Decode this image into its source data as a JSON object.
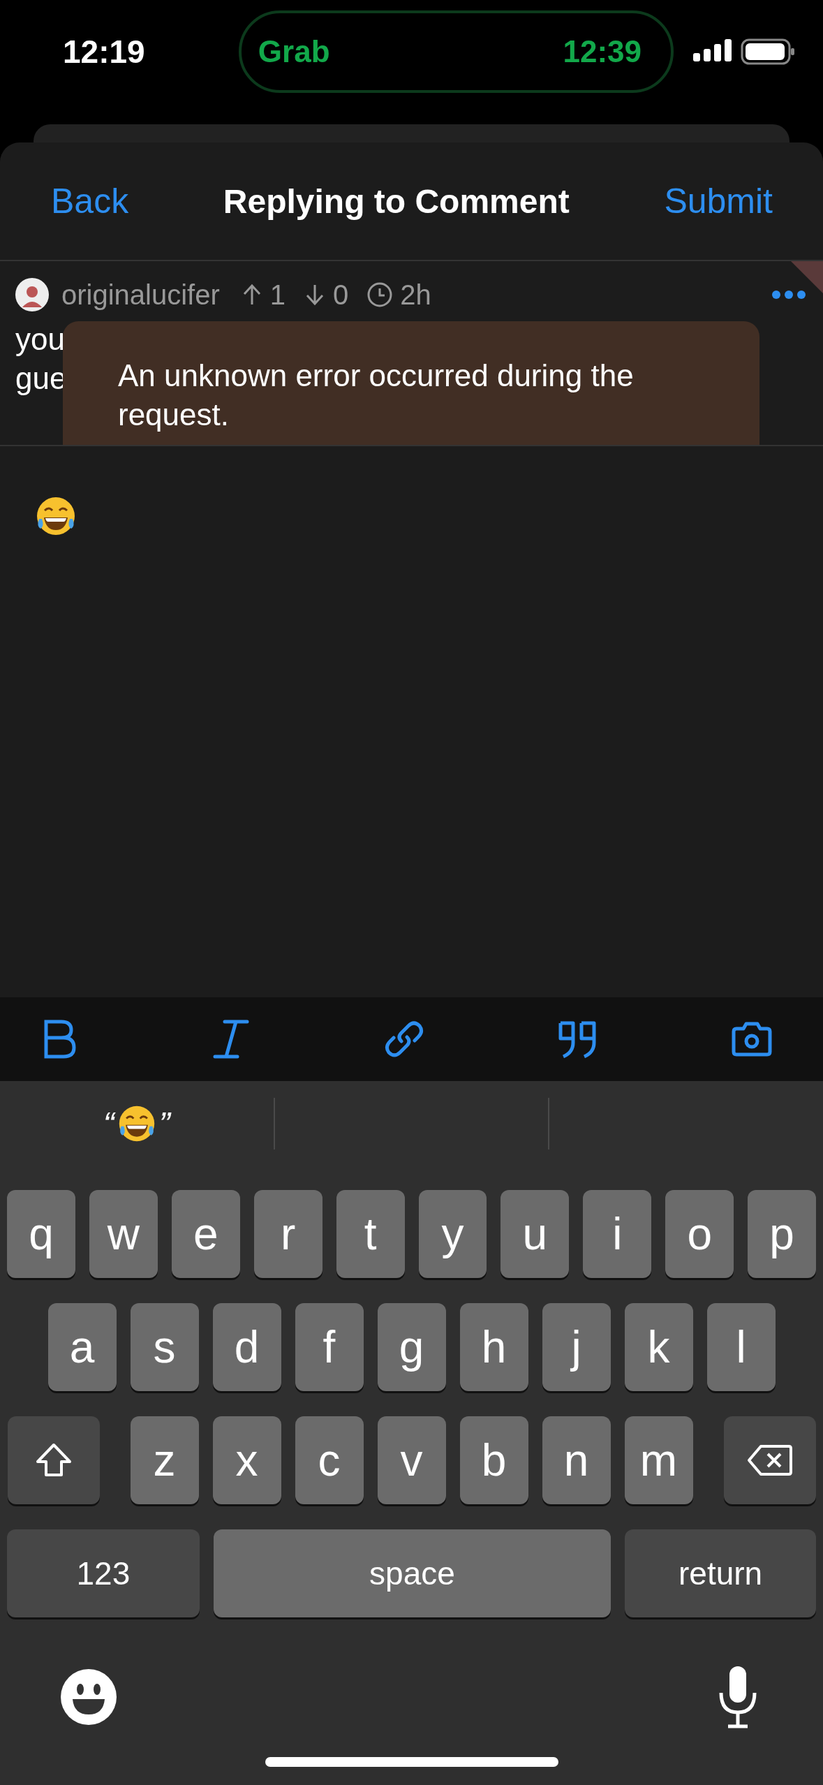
{
  "status_bar": {
    "time": "12:19",
    "island": {
      "app": "Grab",
      "time": "12:39"
    }
  },
  "nav": {
    "back": "Back",
    "title": "Replying to Comment",
    "submit": "Submit"
  },
  "comment": {
    "author": "originalucifer",
    "upvotes": "1",
    "downvotes": "0",
    "age": "2h",
    "body_lines": [
      "you",
      "gue"
    ]
  },
  "toast": {
    "message": "An unknown error occurred during the request."
  },
  "toolbar": [
    {
      "kind": "bold"
    },
    {
      "kind": "italic"
    },
    {
      "kind": "link"
    },
    {
      "kind": "quote"
    },
    {
      "kind": "camera"
    }
  ],
  "suggestions": [
    {
      "open": "“",
      "close": "”"
    }
  ],
  "keyboard": {
    "rows": [
      {
        "keys": [
          {
            "label": "q",
            "kind": "letter"
          },
          {
            "label": "w",
            "kind": "letter"
          },
          {
            "label": "e",
            "kind": "letter"
          },
          {
            "label": "r",
            "kind": "letter"
          },
          {
            "label": "t",
            "kind": "letter"
          },
          {
            "label": "y",
            "kind": "letter"
          },
          {
            "label": "u",
            "kind": "letter"
          },
          {
            "label": "i",
            "kind": "letter"
          },
          {
            "label": "o",
            "kind": "letter"
          },
          {
            "label": "p",
            "kind": "letter"
          }
        ]
      },
      {
        "keys": [
          {
            "label": "a",
            "kind": "letter"
          },
          {
            "label": "s",
            "kind": "letter"
          },
          {
            "label": "d",
            "kind": "letter"
          },
          {
            "label": "f",
            "kind": "letter"
          },
          {
            "label": "g",
            "kind": "letter"
          },
          {
            "label": "h",
            "kind": "letter"
          },
          {
            "label": "j",
            "kind": "letter"
          },
          {
            "label": "k",
            "kind": "letter"
          },
          {
            "label": "l",
            "kind": "letter"
          }
        ]
      },
      {
        "keys": [
          {
            "kind": "shift"
          },
          {
            "label": "z",
            "kind": "letter"
          },
          {
            "label": "x",
            "kind": "letter"
          },
          {
            "label": "c",
            "kind": "letter"
          },
          {
            "label": "v",
            "kind": "letter"
          },
          {
            "label": "b",
            "kind": "letter"
          },
          {
            "label": "n",
            "kind": "letter"
          },
          {
            "label": "m",
            "kind": "letter"
          },
          {
            "kind": "delete"
          }
        ]
      },
      {
        "keys": [
          {
            "label": "123",
            "kind": "mode"
          },
          {
            "label": "space",
            "kind": "space"
          },
          {
            "label": "return",
            "kind": "return"
          }
        ]
      }
    ]
  }
}
